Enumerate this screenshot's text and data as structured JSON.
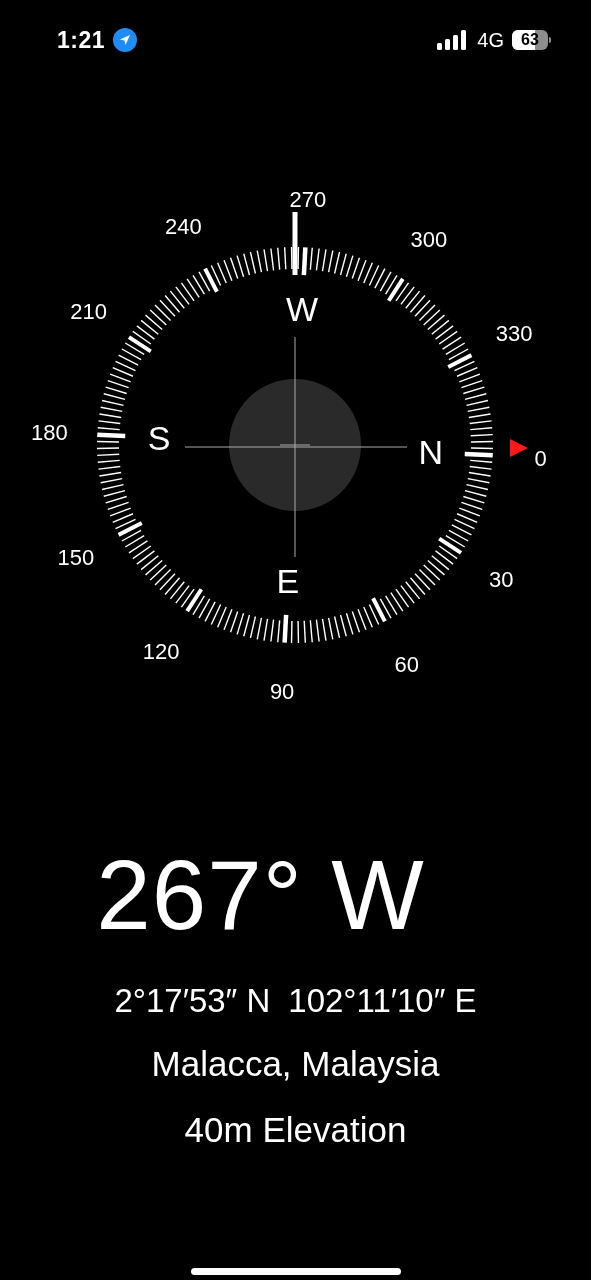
{
  "status_bar": {
    "time": "1:21",
    "network": "4G",
    "battery": "63"
  },
  "compass": {
    "degree_labels": [
      "0",
      "30",
      "60",
      "90",
      "120",
      "150",
      "180",
      "210",
      "240",
      "270",
      "300",
      "330"
    ],
    "cardinals": [
      "N",
      "E",
      "S",
      "W"
    ]
  },
  "readout": {
    "heading": "267° W",
    "latitude": "2°17′53″ N",
    "longitude": "102°11′10″ E",
    "location": "Malacca, Malaysia",
    "elevation": "40m Elevation"
  }
}
